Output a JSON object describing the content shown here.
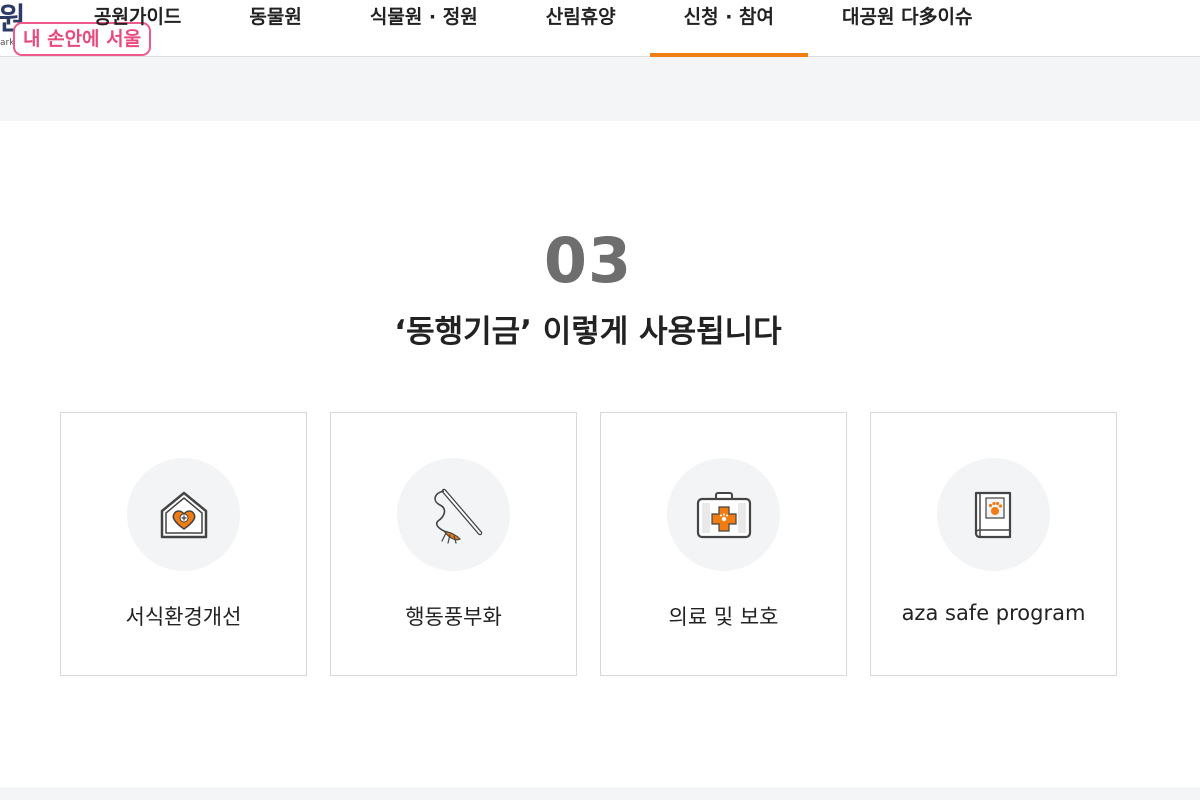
{
  "header": {
    "logo_fragment": "원",
    "logo_sub": "ark",
    "seoul_badge": "내 손안에 서울"
  },
  "gnb": {
    "items": [
      {
        "label": "공원가이드"
      },
      {
        "label": "동물원"
      },
      {
        "label": "식물원 · 정원"
      },
      {
        "label": "산림휴양"
      },
      {
        "label": "신청 · 참여"
      },
      {
        "label": "대공원 다多이슈"
      }
    ],
    "active_index": 4
  },
  "section": {
    "number": "03",
    "title": "‘동행기금’ 이렇게 사용됩니다"
  },
  "cards": [
    {
      "label": "서식환경개선",
      "icon": "house-heart-icon"
    },
    {
      "label": "행동풍부화",
      "icon": "cat-teaser-icon"
    },
    {
      "label": "의료 및 보호",
      "icon": "first-aid-kit-icon"
    },
    {
      "label": "aza safe program",
      "icon": "paw-book-icon"
    }
  ],
  "colors": {
    "accent": "#f07c12",
    "badge_pink": "#ef5a8a",
    "icon_circle_bg": "#f3f4f6",
    "band_gray": "#f4f5f7"
  }
}
